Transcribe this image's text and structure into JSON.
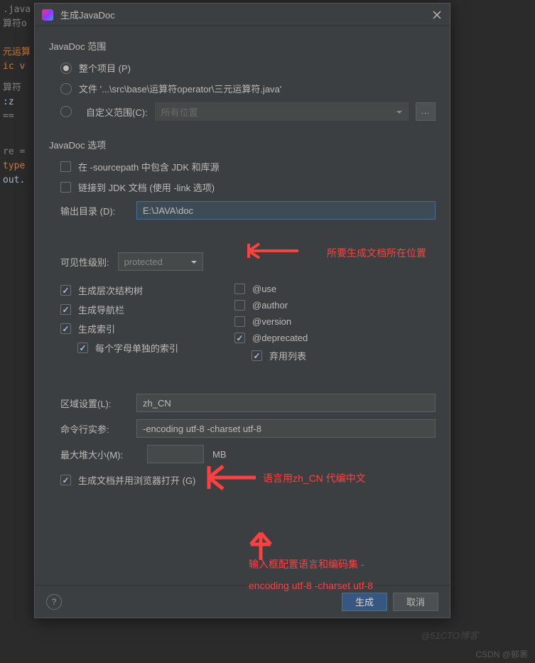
{
  "bg": {
    "line1": ".java",
    "line2": "算符o",
    "line3": "元运算",
    "line4": "ic v",
    "line5": "算符",
    "line6": ":z",
    "line7": "== ",
    "line8": "",
    "line9": "re =",
    "line10": "type",
    "line11": "out."
  },
  "dialog": {
    "title": "生成JavaDoc",
    "section_scope": "JavaDoc 范围",
    "radio_whole_project": "整个项目 (P)",
    "radio_file": "文件 '...\\src\\base\\运算符operator\\三元运算符.java'",
    "radio_custom_scope": "自定义范围(C):",
    "custom_scope_value": "所有位置",
    "section_options": "JavaDoc 选项",
    "chk_sourcepath": "在 -sourcepath 中包含 JDK 和库源",
    "chk_link": "链接到 JDK 文档 (使用 -link 选项)",
    "output_dir_label": "输出目录 (D):",
    "output_dir_value": "E:\\JAVA\\doc",
    "visibility_label": "可见性级别:",
    "visibility_value": "protected",
    "chk_tree": "生成层次结构树",
    "chk_nav": "生成导航栏",
    "chk_index": "生成索引",
    "chk_per_letter": "每个字母单独的索引",
    "chk_use": "@use",
    "chk_author": "@author",
    "chk_version": "@version",
    "chk_deprecated": "@deprecated",
    "chk_deprecated_list": "弃用列表",
    "locale_label": "区域设置(L):",
    "locale_value": "zh_CN",
    "cmdline_label": "命令行实参:",
    "cmdline_value": "-encoding utf-8 -charset utf-8",
    "heap_label": "最大堆大小(M):",
    "heap_unit": "MB",
    "chk_open_browser": "生成文档并用浏览器打开 (G)",
    "btn_generate": "生成",
    "btn_cancel": "取消"
  },
  "annotations": {
    "a1": "所要生成文档所在位置",
    "a2": "语言用zh_CN 代编中文",
    "a3_line1": "输入框配置语言和编码集 -",
    "a3_line2": "encoding utf-8 -charset utf-8"
  },
  "watermark": "CSDN @郁裹",
  "watermark2": "@51CTO博客"
}
